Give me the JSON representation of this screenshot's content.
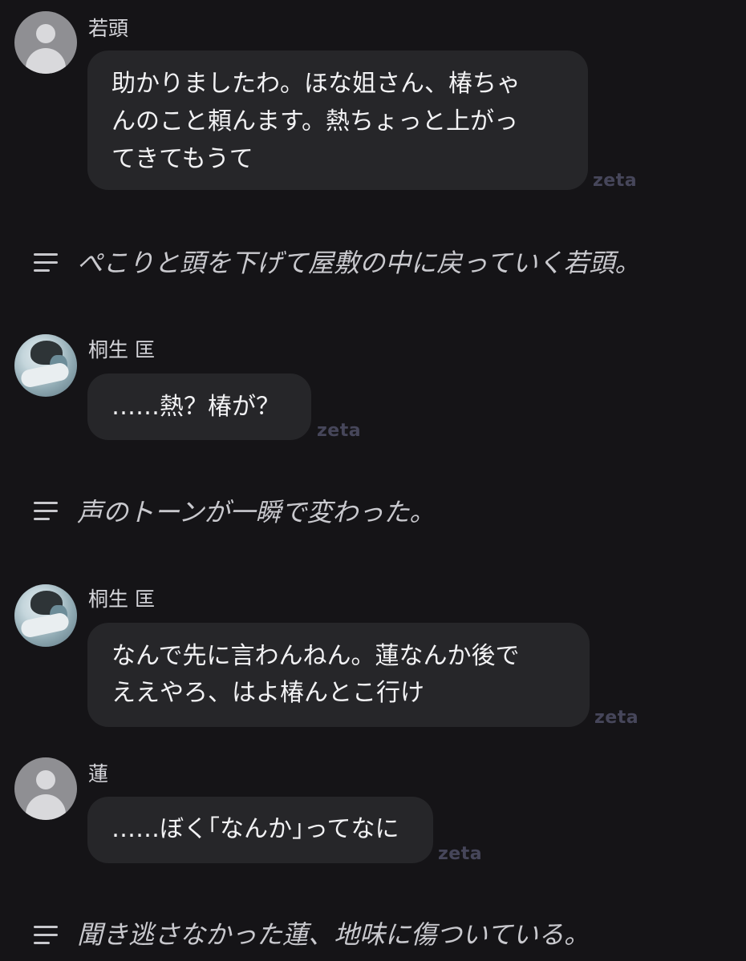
{
  "messages": [
    {
      "speaker": "若頭",
      "avatar": "default-avatar",
      "lines": [
        "助かりましたわ。ほな姐さん、椿ちゃ",
        "んのこと頼んます。熱ちょっと上がっ",
        "てきてもうて"
      ],
      "watermark": "zeta"
    },
    {
      "narration": "ぺこりと頭を下げて屋敷の中に戻っていく若頭。"
    },
    {
      "speaker": "桐生 匡",
      "avatar": "character-photo",
      "lines": [
        "……熱？椿が？"
      ],
      "watermark": "zeta"
    },
    {
      "narration": "声のトーンが一瞬で変わった。"
    },
    {
      "speaker": "桐生 匡",
      "avatar": "character-photo",
      "lines": [
        "なんで先に言わんねん。蓮なんか後で",
        "ええやろ、はよ椿んとこ行け"
      ],
      "watermark": "zeta"
    },
    {
      "speaker": "蓮",
      "avatar": "default-avatar",
      "lines": [
        "……ぼく｢なんか｣ってなに"
      ],
      "watermark": "zeta"
    },
    {
      "narration": "聞き逃さなかった蓮、地味に傷ついている。"
    }
  ],
  "icons": {
    "narration": "narration-lines-icon"
  },
  "colors": {
    "background": "#151417",
    "bubble": "#262629",
    "watermark": "#46465a"
  }
}
